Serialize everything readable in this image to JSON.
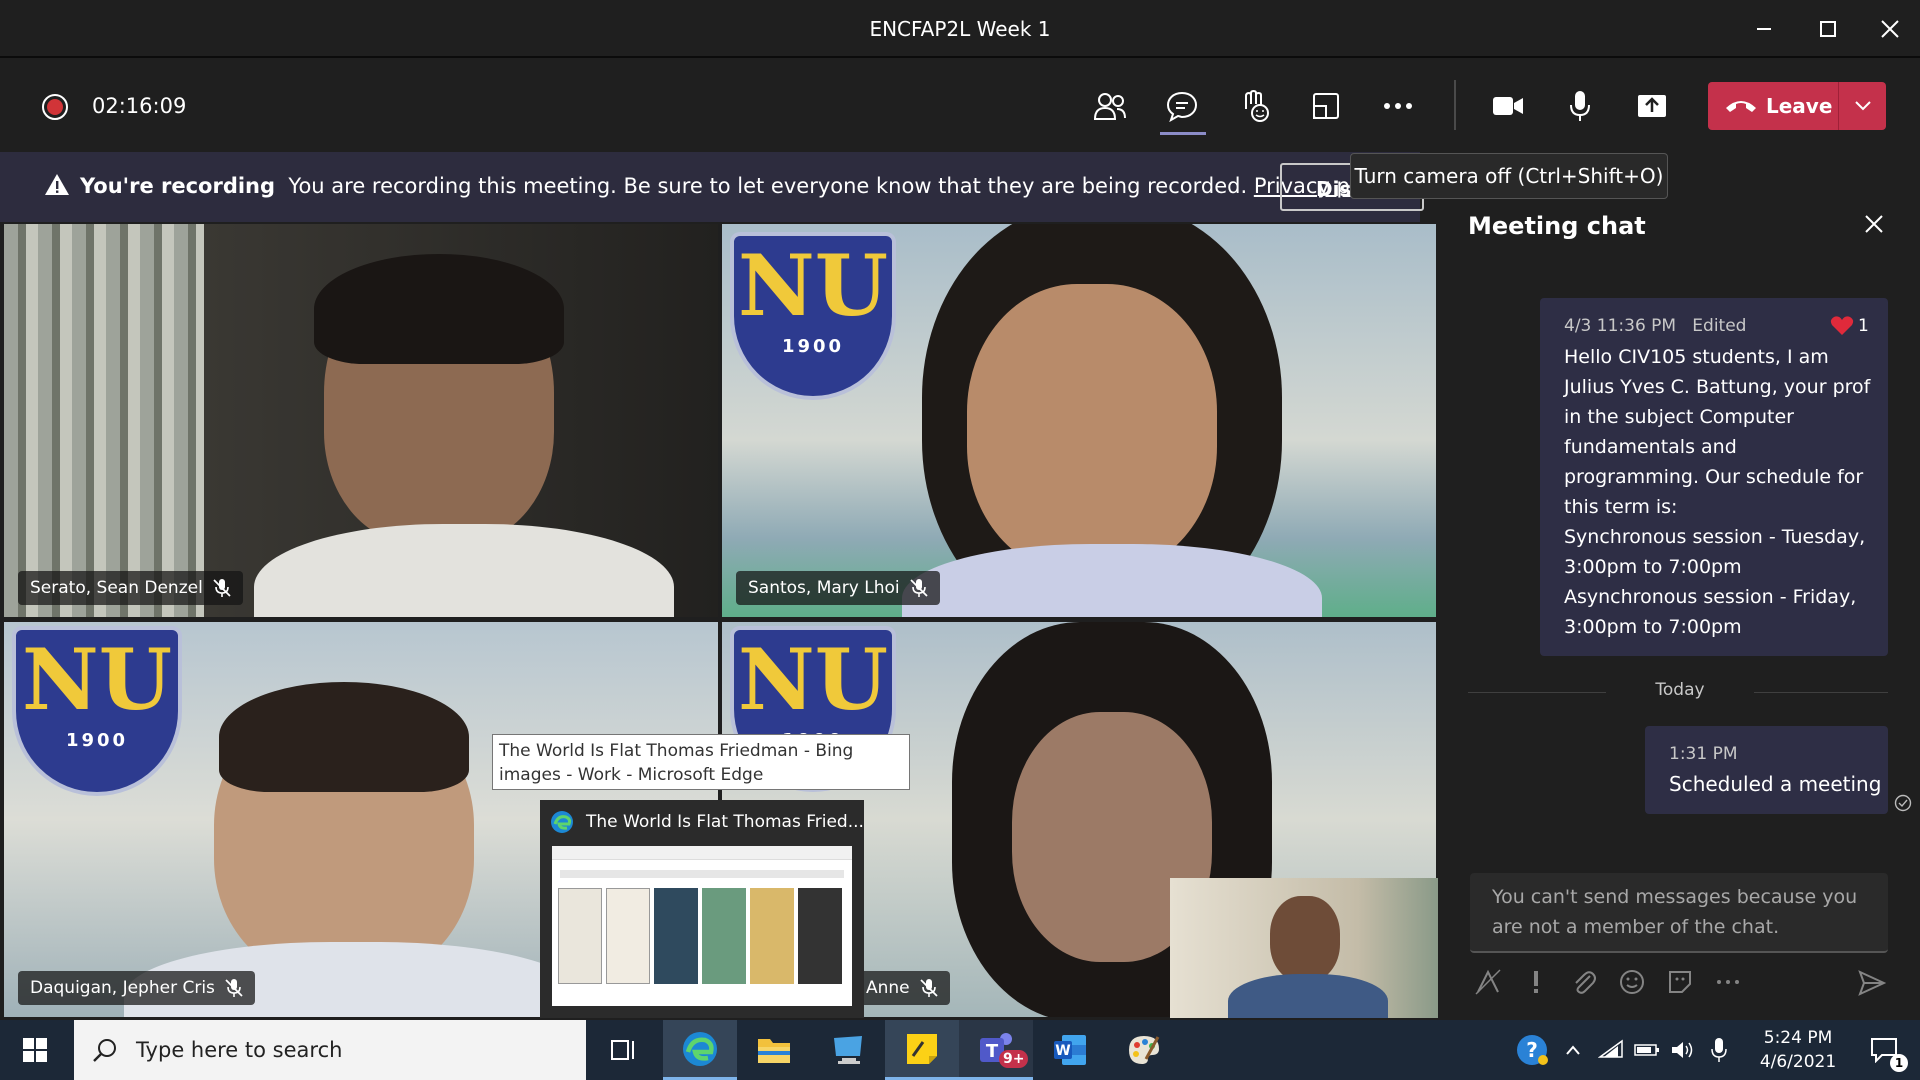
{
  "window": {
    "title": "ENCFAP2L Week 1"
  },
  "toolbar": {
    "timer": "02:16:09",
    "leave_label": "Leave",
    "colors": {
      "leave": "#c4314b",
      "recording": "#d13438"
    }
  },
  "banner": {
    "bold": "You're recording",
    "message": "You are recording this meeting. Be sure to let everyone know that they are being recorded.",
    "link": "Privacy policy",
    "button": "Dis"
  },
  "tooltip": "Turn camera off (Ctrl+Shift+O)",
  "participants": [
    {
      "name": "Serato, Sean Denzel"
    },
    {
      "name": "Santos, Mary Lhoi"
    },
    {
      "name": "Daquigan, Jepher Cris"
    },
    {
      "name": "Anne"
    }
  ],
  "logo": {
    "letters": "NU",
    "year": "1900"
  },
  "edge_preview": {
    "tooltip": "The World Is Flat Thomas Friedman - Bing images - Work - Microsoft Edge",
    "title": "The World Is Flat Thomas Fried..."
  },
  "chat": {
    "title": "Meeting chat",
    "message1": {
      "time": "4/3 11:36 PM",
      "edited": "Edited",
      "reaction_count": "1",
      "text": "Hello CIV105 students, I am Julius Yves C. Battung, your prof in the subject Computer fundamentals and programming. Our schedule for this term is:\nSynchronous session - Tuesday, 3:00pm to 7:00pm\nAsynchronous session - Friday, 3:00pm to 7:00pm"
    },
    "divider": "Today",
    "message2": {
      "time": "1:31 PM",
      "text": "Scheduled a meeting"
    },
    "compose_placeholder": "You can't send messages because you are not a member of the chat."
  },
  "taskbar": {
    "search_placeholder": "Type here to search",
    "teams_badge": "9+",
    "time": "5:24 PM",
    "date": "4/6/2021",
    "notification_count": "1"
  }
}
